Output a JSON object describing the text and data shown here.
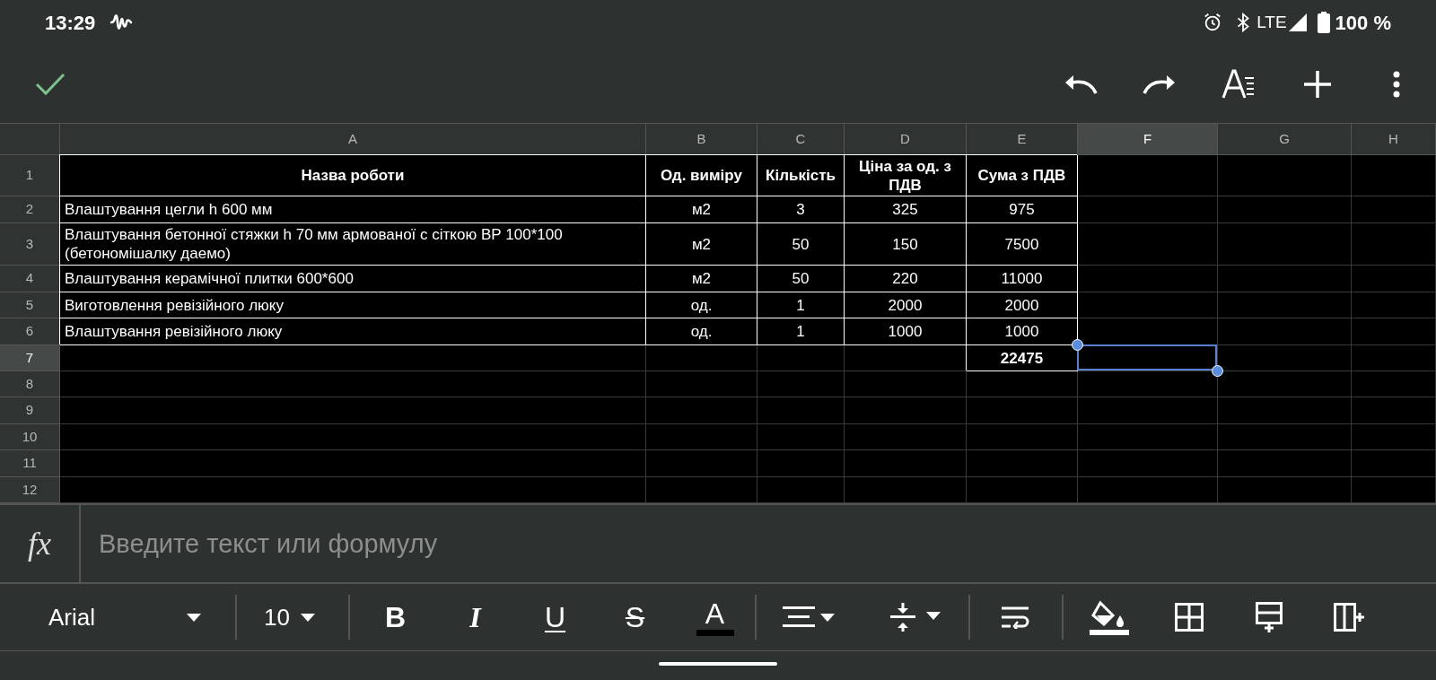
{
  "status_bar": {
    "time": "13:29",
    "network": "LTE",
    "battery": "100 %"
  },
  "columns": [
    {
      "label": "A",
      "selected": false
    },
    {
      "label": "B",
      "selected": false
    },
    {
      "label": "C",
      "selected": false
    },
    {
      "label": "D",
      "selected": false
    },
    {
      "label": "E",
      "selected": false
    },
    {
      "label": "F",
      "selected": true
    },
    {
      "label": "G",
      "selected": false
    },
    {
      "label": "H",
      "selected": false
    }
  ],
  "rows": [
    {
      "number": "1",
      "selected": false,
      "kind": "header",
      "cells": [
        "Назва роботи",
        "Од. виміру",
        "Кількість",
        "Ціна за од. з ПДВ",
        "Сума з ПДВ"
      ]
    },
    {
      "number": "2",
      "selected": false,
      "kind": "item",
      "cells": [
        "Влаштування цегли h 600 мм",
        "м2",
        "3",
        "325",
        "975"
      ]
    },
    {
      "number": "3",
      "selected": false,
      "kind": "item",
      "cells": [
        "Влаштування бетонної стяжки h 70 мм армованої с сіткою ВР 100*100 (бетономішалку даемо)",
        "м2",
        "50",
        "150",
        "7500"
      ]
    },
    {
      "number": "4",
      "selected": false,
      "kind": "item",
      "cells": [
        "Влаштування керамічної плитки 600*600",
        "м2",
        "50",
        "220",
        "11000"
      ]
    },
    {
      "number": "5",
      "selected": false,
      "kind": "item",
      "cells": [
        "Виготовлення ревізійного люку",
        "од.",
        "1",
        "2000",
        "2000"
      ]
    },
    {
      "number": "6",
      "selected": false,
      "kind": "item",
      "cells": [
        "Влаштування ревізійного люку",
        "од.",
        "1",
        "1000",
        "1000"
      ]
    },
    {
      "number": "7",
      "selected": true,
      "kind": "total",
      "total": "22475"
    },
    {
      "number": "8",
      "selected": false,
      "kind": "empty"
    },
    {
      "number": "9",
      "selected": false,
      "kind": "empty"
    },
    {
      "number": "10",
      "selected": false,
      "kind": "empty"
    },
    {
      "number": "11",
      "selected": false,
      "kind": "empty"
    },
    {
      "number": "12",
      "selected": false,
      "kind": "empty"
    }
  ],
  "formula_bar": {
    "label": "fx",
    "placeholder": "Введите текст или формулу"
  },
  "format_toolbar": {
    "font": "Arial",
    "size": "10",
    "text_buttons": [
      {
        "kind": "bold",
        "label": "B"
      },
      {
        "kind": "italic",
        "label": "I"
      },
      {
        "kind": "underline",
        "label": "U"
      },
      {
        "kind": "strikethrough",
        "label": "S"
      },
      {
        "kind": "text-color",
        "label": "A"
      }
    ]
  }
}
